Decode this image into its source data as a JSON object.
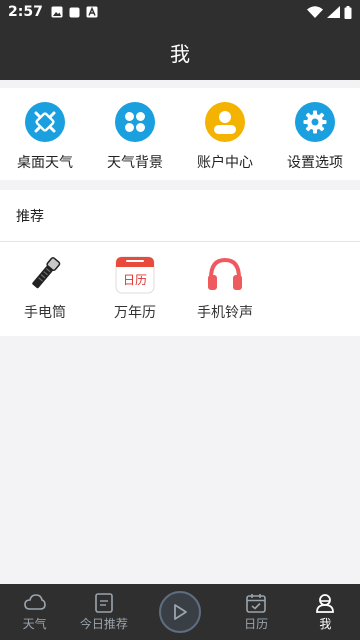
{
  "status_bar": {
    "time": "2:57"
  },
  "header": {
    "title": "我"
  },
  "quick_actions": [
    {
      "label": "桌面天气",
      "icon": "puzzle-icon",
      "color": "#1a9fdf"
    },
    {
      "label": "天气背景",
      "icon": "clover-icon",
      "color": "#1a9fdf"
    },
    {
      "label": "账户中心",
      "icon": "user-icon",
      "color": "#f5b301"
    },
    {
      "label": "设置选项",
      "icon": "gear-icon",
      "color": "#1a9fdf"
    }
  ],
  "recommend": {
    "title": "推荐",
    "items": [
      {
        "label": "手电筒",
        "icon": "flashlight-icon"
      },
      {
        "label": "万年历",
        "icon": "calendar-icon",
        "icon_text": "日历"
      },
      {
        "label": "手机铃声",
        "icon": "headphones-icon"
      }
    ]
  },
  "bottom_nav": [
    {
      "label": "天气",
      "icon": "cloud-icon"
    },
    {
      "label": "今日推荐",
      "icon": "document-icon"
    },
    {
      "label": "",
      "icon": "play-icon"
    },
    {
      "label": "日历",
      "icon": "calendar-check-icon"
    },
    {
      "label": "我",
      "icon": "profile-icon",
      "active": true
    }
  ]
}
